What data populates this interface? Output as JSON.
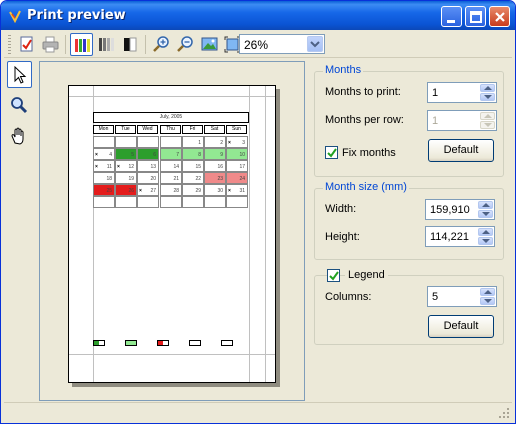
{
  "window": {
    "title": "Print preview"
  },
  "toolbar": {
    "zoom_value": "26%",
    "icons": [
      "print-settings-icon",
      "printer-icon",
      "color-mode-icon",
      "gray-mode-icon",
      "bw-mode-icon",
      "zoom-in-icon",
      "zoom-out-icon",
      "fit-image-icon",
      "fit-page-icon"
    ]
  },
  "left_tools": [
    "pointer-icon",
    "magnifier-icon",
    "hand-icon"
  ],
  "preview": {
    "calendar_title": "July, 2005",
    "day_names": [
      "Mon",
      "Tue",
      "Wed",
      "Thu",
      "Fri",
      "Sat",
      "Sun"
    ],
    "weeks": [
      [
        "",
        "",
        "",
        "",
        "1",
        "2",
        "3"
      ],
      [
        "4",
        "5",
        "6",
        "7",
        "8",
        "9",
        "10"
      ],
      [
        "11",
        "12",
        "13",
        "14",
        "15",
        "16",
        "17"
      ],
      [
        "18",
        "19",
        "20",
        "21",
        "22",
        "23",
        "24"
      ],
      [
        "25",
        "26",
        "27",
        "28",
        "29",
        "30",
        "31"
      ],
      [
        "",
        "",
        "",
        "",
        "",
        "",
        ""
      ]
    ]
  },
  "months_group": {
    "title": "Months",
    "months_to_print_label": "Months to print:",
    "months_to_print_value": "1",
    "months_per_row_label": "Months per row:",
    "months_per_row_value": "1",
    "fix_months_label": "Fix months",
    "fix_months_checked": true,
    "default_button": "Default"
  },
  "month_size_group": {
    "title": "Month size (mm)",
    "width_label": "Width:",
    "width_value": "159,910",
    "height_label": "Height:",
    "height_value": "114,221"
  },
  "legend_group": {
    "legend_label": "Legend",
    "legend_checked": true,
    "columns_label": "Columns:",
    "columns_value": "5",
    "default_button": "Default"
  },
  "colors": {
    "title_bar": "#0a54d4",
    "group_title": "#0046d5",
    "light_green": "#92e892",
    "dark_green": "#2c9e2c",
    "light_red": "#f08a8a",
    "dark_red": "#e41c1c"
  }
}
